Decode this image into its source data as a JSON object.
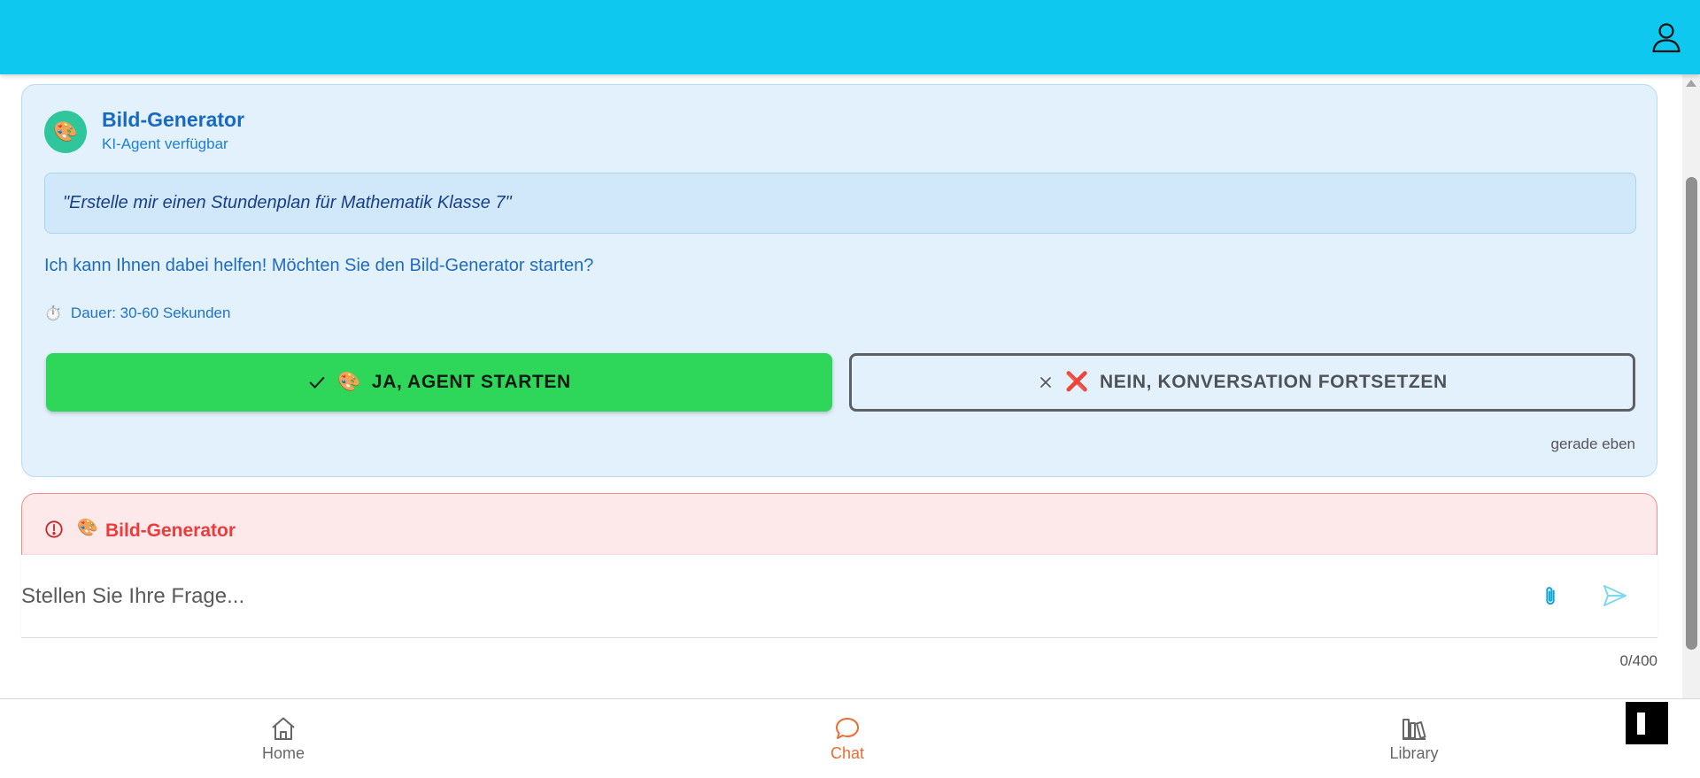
{
  "colors": {
    "header": "#0ec8ef",
    "agent_card_bg": "#e3f1fd",
    "primary_button": "#2ed65a",
    "error_text": "#ec3b3b",
    "nav_active": "#ef6a33"
  },
  "header": {
    "profile_icon": "user-icon"
  },
  "agent_card": {
    "avatar_icon": "palette-icon",
    "avatar_emoji": "🎨",
    "title": "Bild-Generator",
    "subtitle": "KI-Agent verfügbar",
    "prompt": "\"Erstelle mir einen Stundenplan für Mathematik Klasse 7\"",
    "message": "Ich kann Ihnen dabei helfen! Möchten Sie den Bild-Generator starten?",
    "duration_emoji": "⏱️",
    "duration": "Dauer: 30-60 Sekunden",
    "confirm_button": {
      "icon": "check-icon",
      "emoji": "🎨",
      "label": "JA, AGENT STARTEN"
    },
    "decline_button": {
      "icon": "close-icon",
      "emoji": "❌",
      "label": "NEIN, KONVERSATION FORTSETZEN"
    },
    "timestamp": "gerade eben"
  },
  "error_card": {
    "icon": "alert-circle-icon",
    "emoji": "🎨",
    "title": "Bild-Generator"
  },
  "input": {
    "placeholder": "Stellen Sie Ihre Frage...",
    "value": "",
    "attach_icon": "paperclip-icon",
    "send_icon": "send-icon",
    "counter": "0/400"
  },
  "bottom_nav": {
    "items": [
      {
        "label": "Home",
        "icon": "home-icon",
        "active": false
      },
      {
        "label": "Chat",
        "icon": "chat-bubble-icon",
        "active": true
      },
      {
        "label": "Library",
        "icon": "library-icon",
        "active": false
      }
    ]
  }
}
